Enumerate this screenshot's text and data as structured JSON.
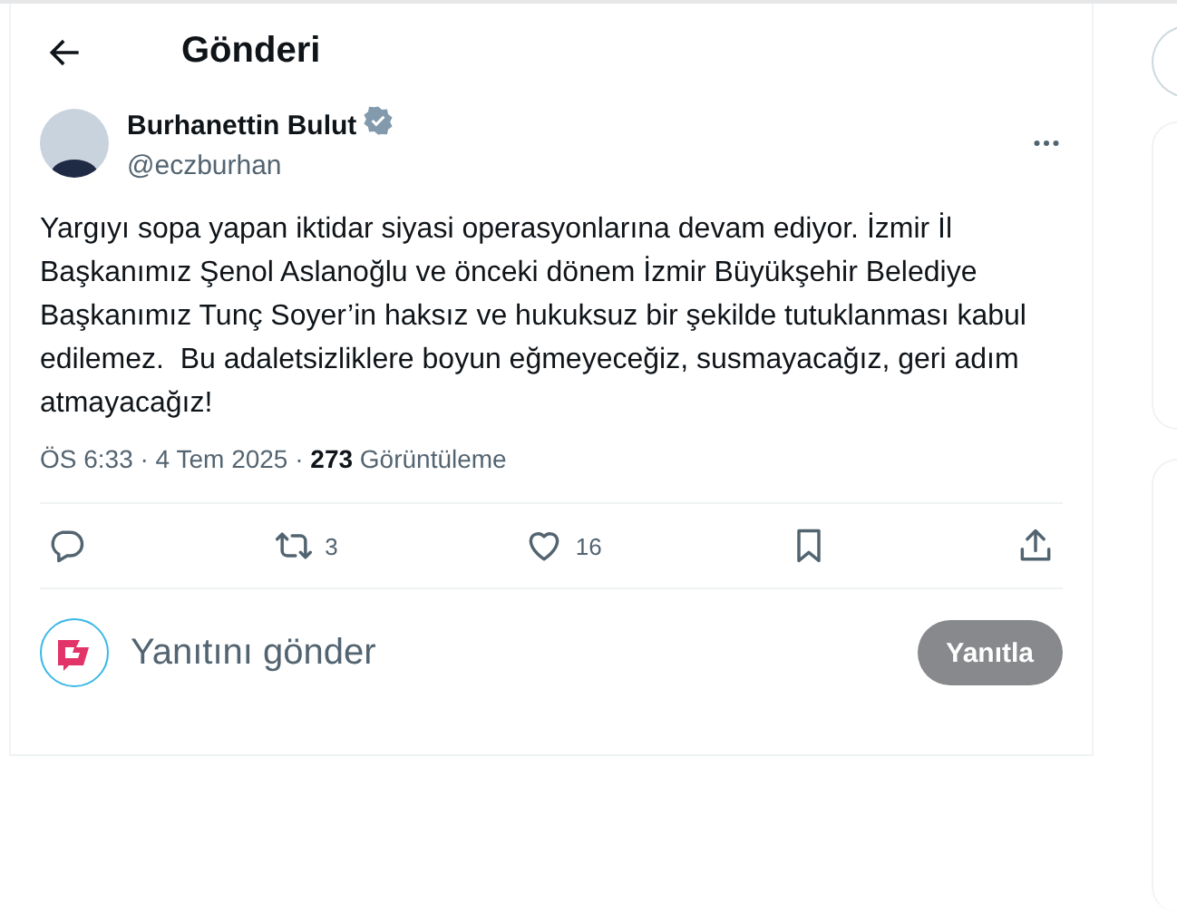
{
  "header": {
    "title": "Gönderi"
  },
  "post": {
    "author": {
      "name": "Burhanettin Bulut",
      "handle": "@eczburhan",
      "verified": true
    },
    "text": "Yargıyı sopa yapan iktidar siyasi operasyonlarına devam ediyor. İzmir İl Başkanımız Şenol Aslanoğlu ve önceki dönem İzmir Büyükşehir Belediye Başkanımız Tunç Soyer’in haksız ve hukuksuz bir şekilde tutuklanması kabul edilemez.  Bu adaletsizliklere boyun eğmeyeceğiz, susmayacağız, geri adım atmayacağız!",
    "meta": "ÖS 6:33 · 4 Tem 2025 · **273** Görüntüleme",
    "actions": [
      {
        "kind": "reply"
      },
      {
        "kind": "repost",
        "count": "3"
      },
      {
        "kind": "like",
        "count": "16"
      },
      {
        "kind": "bookmark"
      },
      {
        "kind": "share"
      }
    ]
  },
  "reply": {
    "placeholder": "Yanıtını gönder",
    "button": "Yanıtla",
    "disabled": true
  }
}
